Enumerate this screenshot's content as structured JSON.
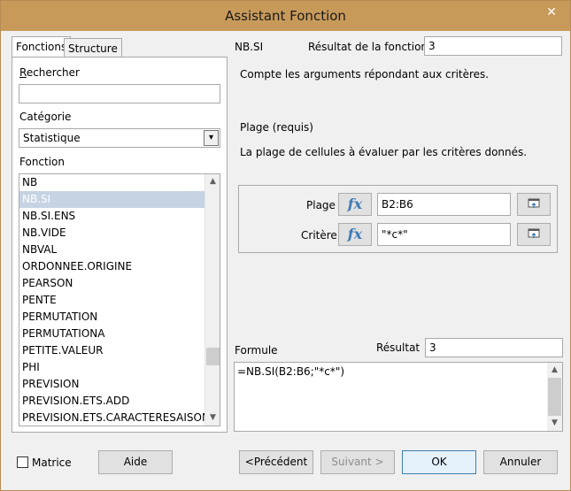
{
  "window": {
    "title": "Assistant Fonction",
    "close_glyph": "✕"
  },
  "tabs": [
    {
      "label": "Fonctions"
    },
    {
      "label": "Structure"
    }
  ],
  "search": {
    "label": "Rechercher",
    "value": ""
  },
  "category": {
    "label": "Catégorie",
    "value": "Statistique"
  },
  "function_list": {
    "label": "Fonction",
    "items": [
      "NB",
      "NB.SI",
      "NB.SI.ENS",
      "NB.VIDE",
      "NBVAL",
      "ORDONNEE.ORIGINE",
      "PEARSON",
      "PENTE",
      "PERMUTATION",
      "PERMUTATIONA",
      "PETITE.VALEUR",
      "PHI",
      "PREVISION",
      "PREVISION.ETS.ADD",
      "PREVISION.ETS.CARACTERESAISONNIERE"
    ],
    "selected_index": 1
  },
  "function": {
    "name": "NB.SI",
    "result_label": "Résultat de la fonction",
    "result_value": "3",
    "description": "Compte les arguments répondant aux critères.",
    "arg_title": "Plage (requis)",
    "arg_description": "La plage de cellules à évaluer par les critères donnés."
  },
  "args": [
    {
      "label": "Plage",
      "value": "B2:B6"
    },
    {
      "label": "Critère",
      "value": "\"*c*\""
    }
  ],
  "fx_glyph": "fx",
  "formula": {
    "label": "Formule",
    "value": "=NB.SI(B2:B6;\"*c*\")",
    "result_label": "Résultat",
    "result_value": "3"
  },
  "footer": {
    "matrix_label": "Matrice",
    "help_label": "Aide",
    "prev_label": "<Précédent",
    "next_label": "Suivant >",
    "ok_label": "OK",
    "cancel_label": "Annuler"
  }
}
